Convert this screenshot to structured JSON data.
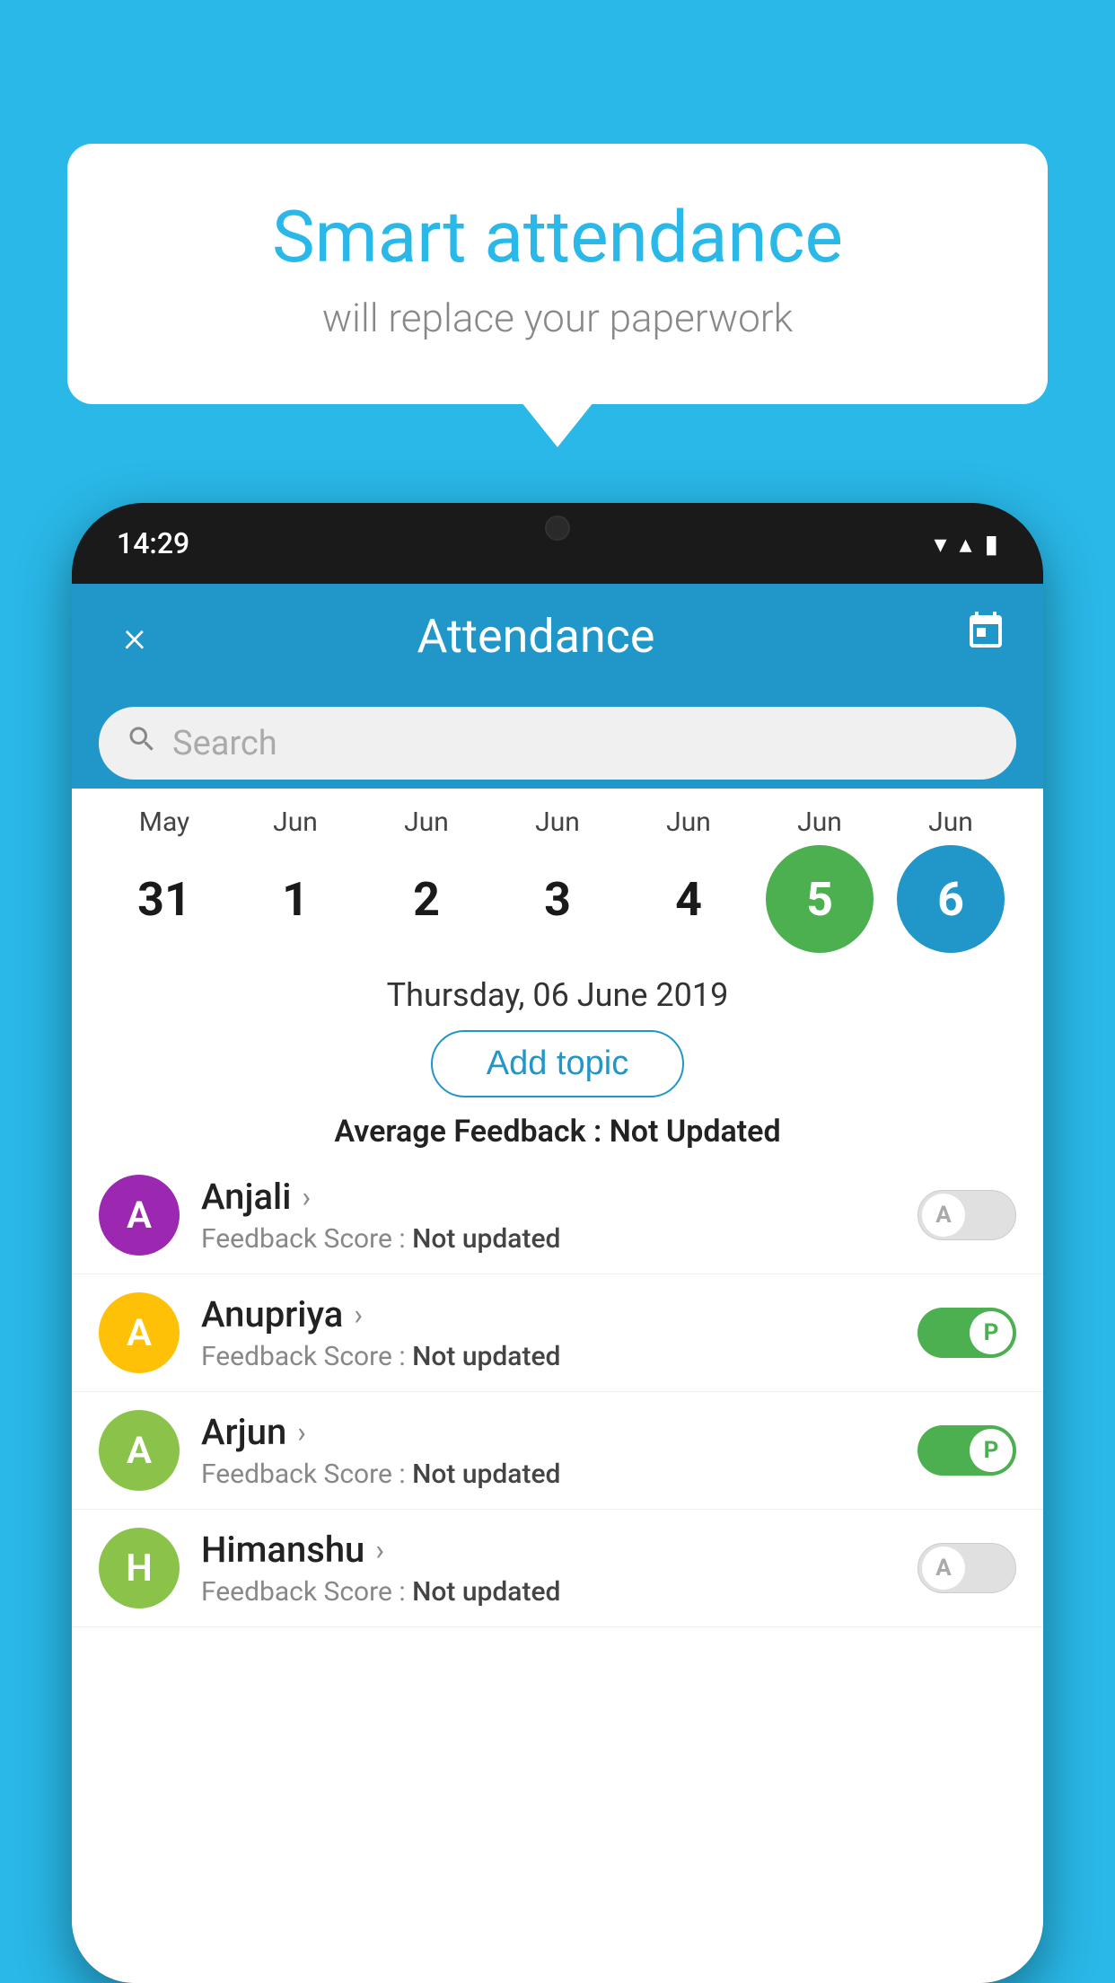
{
  "background_color": "#29B8E8",
  "speech_bubble": {
    "title": "Smart attendance",
    "subtitle": "will replace your paperwork"
  },
  "status_bar": {
    "time": "14:29",
    "wifi_icon": "▼",
    "signal_icon": "▲",
    "battery_icon": "▮"
  },
  "app_header": {
    "close_label": "×",
    "title": "Attendance",
    "calendar_icon": "📅"
  },
  "search": {
    "placeholder": "Search"
  },
  "calendar": {
    "days": [
      {
        "month": "May",
        "date": "31",
        "state": "normal"
      },
      {
        "month": "Jun",
        "date": "1",
        "state": "normal"
      },
      {
        "month": "Jun",
        "date": "2",
        "state": "normal"
      },
      {
        "month": "Jun",
        "date": "3",
        "state": "normal"
      },
      {
        "month": "Jun",
        "date": "4",
        "state": "normal"
      },
      {
        "month": "Jun",
        "date": "5",
        "state": "today"
      },
      {
        "month": "Jun",
        "date": "6",
        "state": "selected"
      }
    ]
  },
  "selected_date": "Thursday, 06 June 2019",
  "add_topic_label": "Add topic",
  "avg_feedback_label": "Average Feedback : ",
  "avg_feedback_value": "Not Updated",
  "students": [
    {
      "name": "Anjali",
      "feedback_label": "Feedback Score : ",
      "feedback_value": "Not updated",
      "avatar_letter": "A",
      "avatar_color": "#9C27B0",
      "attendance": "absent"
    },
    {
      "name": "Anupriya",
      "feedback_label": "Feedback Score : ",
      "feedback_value": "Not updated",
      "avatar_letter": "A",
      "avatar_color": "#FFC107",
      "attendance": "present"
    },
    {
      "name": "Arjun",
      "feedback_label": "Feedback Score : ",
      "feedback_value": "Not updated",
      "avatar_letter": "A",
      "avatar_color": "#8BC34A",
      "attendance": "present"
    },
    {
      "name": "Himanshu",
      "feedback_label": "Feedback Score : ",
      "feedback_value": "Not updated",
      "avatar_letter": "H",
      "avatar_color": "#8BC34A",
      "attendance": "absent"
    }
  ],
  "toggle_absent_letter": "A",
  "toggle_present_letter": "P"
}
